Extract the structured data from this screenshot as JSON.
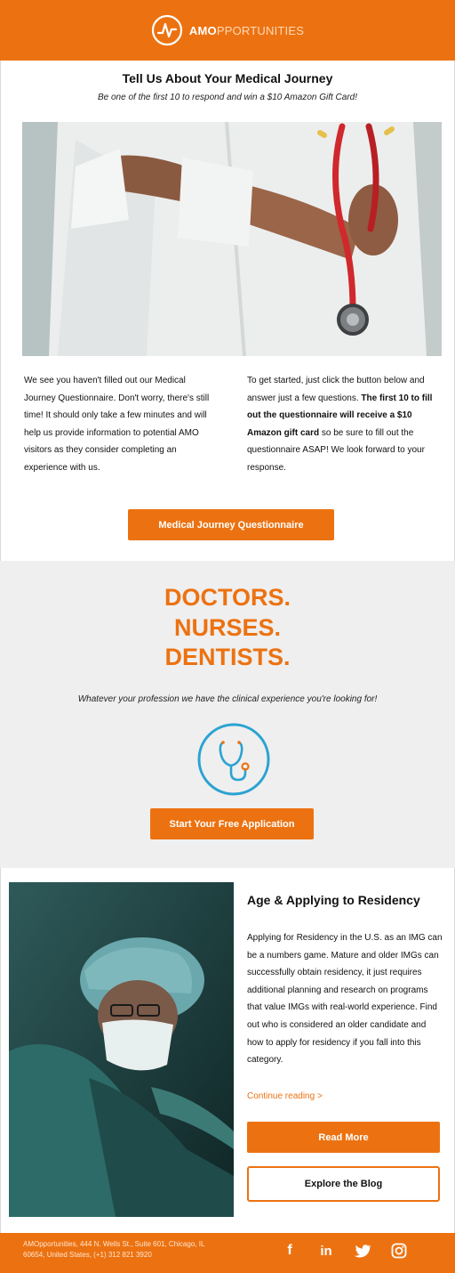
{
  "header": {
    "logo_bold": "AMO",
    "logo_light": "PPORTUNITIES",
    "brand_color": "#ec7211"
  },
  "intro": {
    "title": "Tell Us About Your Medical Journey",
    "subtitle": "Be one of the first 10 to respond and win a $10 Amazon Gift Card!"
  },
  "body": {
    "left_paragraph": "We see you haven't filled out our Medical Journey Questionnaire. Don't worry, there's still time! It should only take a few minutes and will help us provide information to potential AMO visitors as they consider completing an experience with us.",
    "right_part1": "To get started, just click the button below and answer just a few questions. ",
    "right_bold": "The first 10 to fill out the questionnaire will receive a $10 Amazon gift card",
    "right_part2": " so be sure to fill out the questionnaire ASAP! We look forward to your response.",
    "questionnaire_button": "Medical Journey Questionnaire"
  },
  "professions": {
    "line1": "DOCTORS.",
    "line2": "NURSES.",
    "line3": "DENTISTS.",
    "tagline": "Whatever your profession we have the clinical experience you're looking for!",
    "icon": "stethoscope-icon",
    "apply_button": "Start Your Free Application"
  },
  "blog": {
    "title": "Age & Applying to Residency",
    "body": "Applying for Residency in the U.S. as an IMG can be a numbers game. Mature and older IMGs can successfully obtain residency, it just requires additional planning and research on programs that value IMGs with real-world experience. Find out who is considered an older candidate and how to apply for residency if you fall into this category.",
    "continue_link": "Continue reading >",
    "read_more_button": "Read More",
    "explore_button": "Explore the Blog"
  },
  "footer": {
    "address": "AMOpportunities, 444 N. Wells St., Suite 601, Chicago, IL 60654, United States, (+1) 312 821 3920",
    "social": [
      {
        "name": "facebook-icon",
        "glyph": "f"
      },
      {
        "name": "linkedin-icon",
        "glyph": "in"
      },
      {
        "name": "twitter-icon",
        "glyph": ""
      },
      {
        "name": "instagram-icon",
        "glyph": ""
      }
    ]
  }
}
